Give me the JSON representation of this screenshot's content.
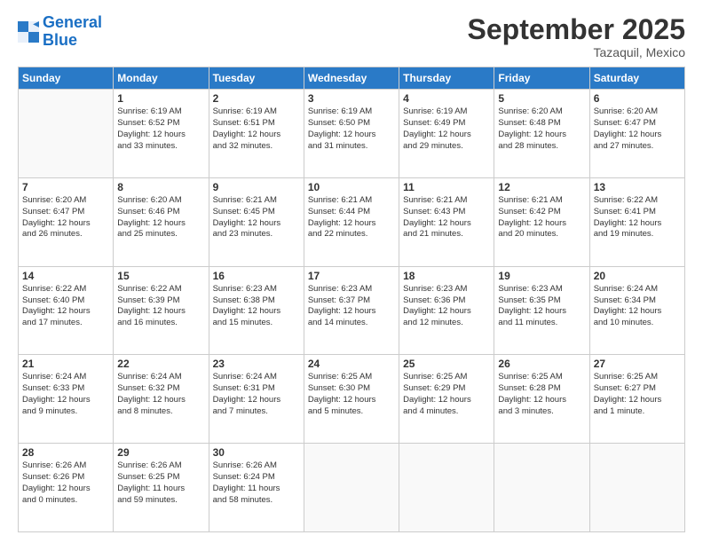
{
  "logo": {
    "line1": "General",
    "line2": "Blue"
  },
  "title": "September 2025",
  "location": "Tazaquil, Mexico",
  "weekdays": [
    "Sunday",
    "Monday",
    "Tuesday",
    "Wednesday",
    "Thursday",
    "Friday",
    "Saturday"
  ],
  "weeks": [
    [
      {
        "day": "",
        "info": ""
      },
      {
        "day": "1",
        "info": "Sunrise: 6:19 AM\nSunset: 6:52 PM\nDaylight: 12 hours\nand 33 minutes."
      },
      {
        "day": "2",
        "info": "Sunrise: 6:19 AM\nSunset: 6:51 PM\nDaylight: 12 hours\nand 32 minutes."
      },
      {
        "day": "3",
        "info": "Sunrise: 6:19 AM\nSunset: 6:50 PM\nDaylight: 12 hours\nand 31 minutes."
      },
      {
        "day": "4",
        "info": "Sunrise: 6:19 AM\nSunset: 6:49 PM\nDaylight: 12 hours\nand 29 minutes."
      },
      {
        "day": "5",
        "info": "Sunrise: 6:20 AM\nSunset: 6:48 PM\nDaylight: 12 hours\nand 28 minutes."
      },
      {
        "day": "6",
        "info": "Sunrise: 6:20 AM\nSunset: 6:47 PM\nDaylight: 12 hours\nand 27 minutes."
      }
    ],
    [
      {
        "day": "7",
        "info": "Sunrise: 6:20 AM\nSunset: 6:47 PM\nDaylight: 12 hours\nand 26 minutes."
      },
      {
        "day": "8",
        "info": "Sunrise: 6:20 AM\nSunset: 6:46 PM\nDaylight: 12 hours\nand 25 minutes."
      },
      {
        "day": "9",
        "info": "Sunrise: 6:21 AM\nSunset: 6:45 PM\nDaylight: 12 hours\nand 23 minutes."
      },
      {
        "day": "10",
        "info": "Sunrise: 6:21 AM\nSunset: 6:44 PM\nDaylight: 12 hours\nand 22 minutes."
      },
      {
        "day": "11",
        "info": "Sunrise: 6:21 AM\nSunset: 6:43 PM\nDaylight: 12 hours\nand 21 minutes."
      },
      {
        "day": "12",
        "info": "Sunrise: 6:21 AM\nSunset: 6:42 PM\nDaylight: 12 hours\nand 20 minutes."
      },
      {
        "day": "13",
        "info": "Sunrise: 6:22 AM\nSunset: 6:41 PM\nDaylight: 12 hours\nand 19 minutes."
      }
    ],
    [
      {
        "day": "14",
        "info": "Sunrise: 6:22 AM\nSunset: 6:40 PM\nDaylight: 12 hours\nand 17 minutes."
      },
      {
        "day": "15",
        "info": "Sunrise: 6:22 AM\nSunset: 6:39 PM\nDaylight: 12 hours\nand 16 minutes."
      },
      {
        "day": "16",
        "info": "Sunrise: 6:23 AM\nSunset: 6:38 PM\nDaylight: 12 hours\nand 15 minutes."
      },
      {
        "day": "17",
        "info": "Sunrise: 6:23 AM\nSunset: 6:37 PM\nDaylight: 12 hours\nand 14 minutes."
      },
      {
        "day": "18",
        "info": "Sunrise: 6:23 AM\nSunset: 6:36 PM\nDaylight: 12 hours\nand 12 minutes."
      },
      {
        "day": "19",
        "info": "Sunrise: 6:23 AM\nSunset: 6:35 PM\nDaylight: 12 hours\nand 11 minutes."
      },
      {
        "day": "20",
        "info": "Sunrise: 6:24 AM\nSunset: 6:34 PM\nDaylight: 12 hours\nand 10 minutes."
      }
    ],
    [
      {
        "day": "21",
        "info": "Sunrise: 6:24 AM\nSunset: 6:33 PM\nDaylight: 12 hours\nand 9 minutes."
      },
      {
        "day": "22",
        "info": "Sunrise: 6:24 AM\nSunset: 6:32 PM\nDaylight: 12 hours\nand 8 minutes."
      },
      {
        "day": "23",
        "info": "Sunrise: 6:24 AM\nSunset: 6:31 PM\nDaylight: 12 hours\nand 7 minutes."
      },
      {
        "day": "24",
        "info": "Sunrise: 6:25 AM\nSunset: 6:30 PM\nDaylight: 12 hours\nand 5 minutes."
      },
      {
        "day": "25",
        "info": "Sunrise: 6:25 AM\nSunset: 6:29 PM\nDaylight: 12 hours\nand 4 minutes."
      },
      {
        "day": "26",
        "info": "Sunrise: 6:25 AM\nSunset: 6:28 PM\nDaylight: 12 hours\nand 3 minutes."
      },
      {
        "day": "27",
        "info": "Sunrise: 6:25 AM\nSunset: 6:27 PM\nDaylight: 12 hours\nand 1 minute."
      }
    ],
    [
      {
        "day": "28",
        "info": "Sunrise: 6:26 AM\nSunset: 6:26 PM\nDaylight: 12 hours\nand 0 minutes."
      },
      {
        "day": "29",
        "info": "Sunrise: 6:26 AM\nSunset: 6:25 PM\nDaylight: 11 hours\nand 59 minutes."
      },
      {
        "day": "30",
        "info": "Sunrise: 6:26 AM\nSunset: 6:24 PM\nDaylight: 11 hours\nand 58 minutes."
      },
      {
        "day": "",
        "info": ""
      },
      {
        "day": "",
        "info": ""
      },
      {
        "day": "",
        "info": ""
      },
      {
        "day": "",
        "info": ""
      }
    ]
  ]
}
